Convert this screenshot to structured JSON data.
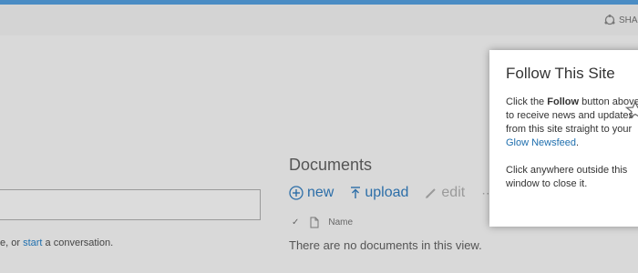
{
  "suite_bar": {
    "share_label": "SHA"
  },
  "newsfeed": {
    "conversation_prefix": "e, or ",
    "conversation_link": "start",
    "conversation_suffix": " a conversation."
  },
  "documents": {
    "title": "Documents",
    "actions": {
      "new_label": "new",
      "upload_label": "upload",
      "edit_label": "edit"
    },
    "column_name": "Name",
    "empty_message": "There are no documents in this view."
  },
  "callout": {
    "title": "Follow This Site",
    "body_part1": "Click the ",
    "body_bold": "Follow",
    "body_part2": " button above to receive news and updates from this site straight to your ",
    "body_link": "Glow Newsfeed",
    "body_part3": ".",
    "body_close": "Click anywhere outside this window to close it."
  },
  "colors": {
    "accent_bar": "#4a8cc4",
    "link": "#1f6fae",
    "action_blue": "#2c6ea8"
  }
}
